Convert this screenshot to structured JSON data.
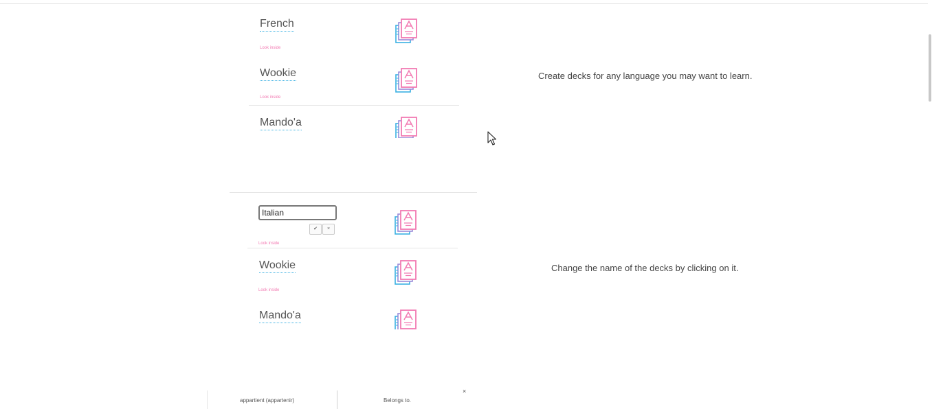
{
  "scrollbar": {
    "present": true
  },
  "section1": {
    "caption": "Create decks for any language you may want to learn.",
    "decks": [
      {
        "name": "French",
        "link": "Look inside"
      },
      {
        "name": "Wookie",
        "link": "Look inside"
      },
      {
        "name": "Mando'a"
      }
    ]
  },
  "section2": {
    "caption": "Change the name of the decks by clicking on it.",
    "editing": {
      "value": "Italian",
      "confirm_icon": "check-icon",
      "cancel_icon": "close-icon",
      "confirm_glyph": "✔",
      "cancel_glyph": "×",
      "link": "Look inside"
    },
    "decks": [
      {
        "name": "Wookie",
        "link": "Look inside"
      },
      {
        "name": "Mando'a"
      }
    ]
  },
  "bottom_panel": {
    "word": "appartient (appartenir)",
    "definition": "Belongs to.",
    "close_glyph": "×"
  },
  "colors": {
    "accent_pink": "#f27ab2",
    "accent_blue": "#3ab0e2"
  }
}
